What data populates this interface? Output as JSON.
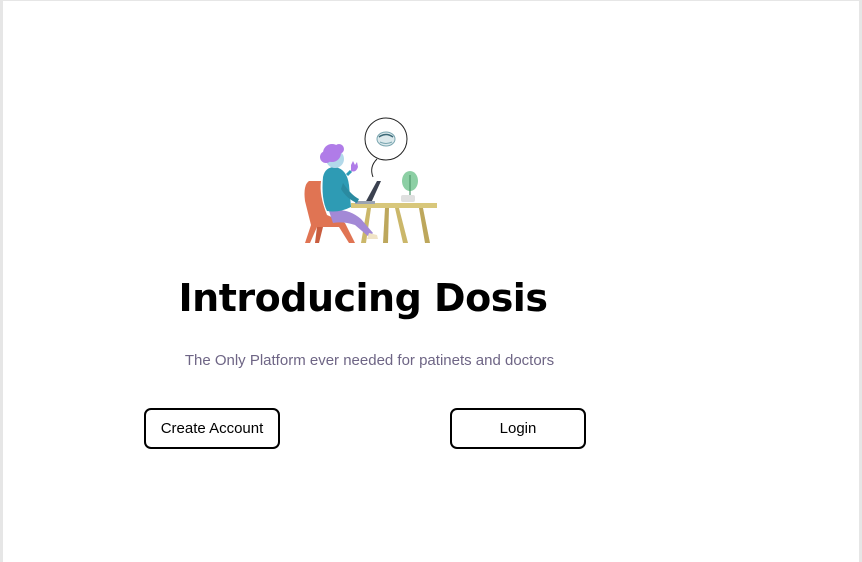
{
  "hero": {
    "illustration_icon": "person-working-at-laptop-illustration",
    "title": "Introducing Dosis",
    "subtitle": "The Only Platform ever needed for patinets and doctors"
  },
  "actions": {
    "create_account_label": "Create Account",
    "login_label": "Login"
  },
  "colors": {
    "background": "#ffffff",
    "subtitle_text": "#6e6585",
    "button_border": "#000000"
  }
}
